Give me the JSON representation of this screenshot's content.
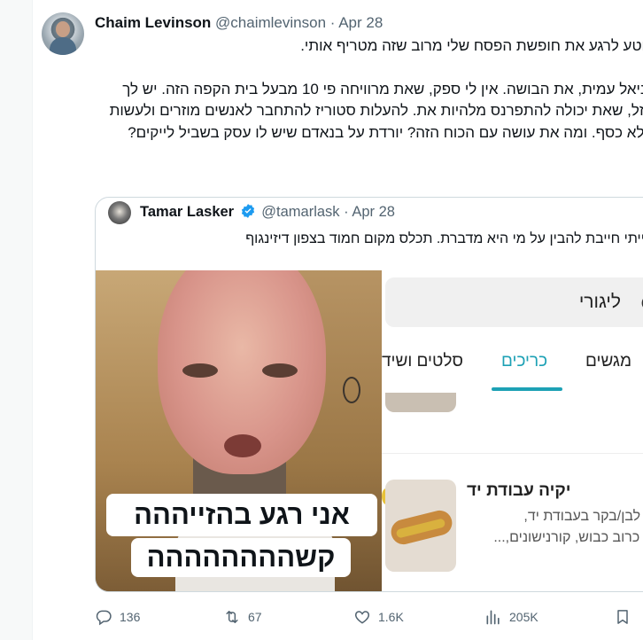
{
  "author": {
    "name": "Chaim Levinson",
    "handle": "@chaimlevinson",
    "date": "Apr 28"
  },
  "tweet": {
    "para1": "קוטע לרגע את חופשת הפסח שלי מרוב שזה מטריף אותי.",
    "para2": "דניאל עמית, את הבושה. אין לי ספק, שאת מרוויחה פי 10 מבעל בית הקפה הזה. יש לך מזל, שאת יכולה להתפרנס מלהיות את. להעלות סטוריז להתחבר לאנשים מוזרים ולעשות מלא כסף. ומה את עושה עם הכוח הזה? יורדת על בנאדם שיש לו עסק בשביל לייקים?"
  },
  "quote": {
    "name": "Tamar Lasker",
    "handle": "@tamarlask",
    "date": "Apr 28",
    "text": "הייתי חייבת להבין על מי היא מדברת. תכלס מקום חמוד בצפון דיזינגוף",
    "caption_line1": "אני רגע בהזייההה",
    "caption_line2": "קשהההההההה",
    "search_label": "ליגורי",
    "tabs": [
      "מגשים",
      "כריכים",
      "סלטים ושיד"
    ],
    "item_title": "יקיה עבודת יד",
    "item_desc1": "בשר לבן/בקר בעבודת יד,",
    "item_desc2": "רדל, כרוב כבוש, קורנישונים,..."
  },
  "actions": {
    "replies": "136",
    "reposts": "67",
    "likes": "1.6K",
    "views": "205K"
  },
  "colors": {
    "accent": "#1d9bf0",
    "muted": "#536471",
    "tab_active": "#1da1b5"
  }
}
